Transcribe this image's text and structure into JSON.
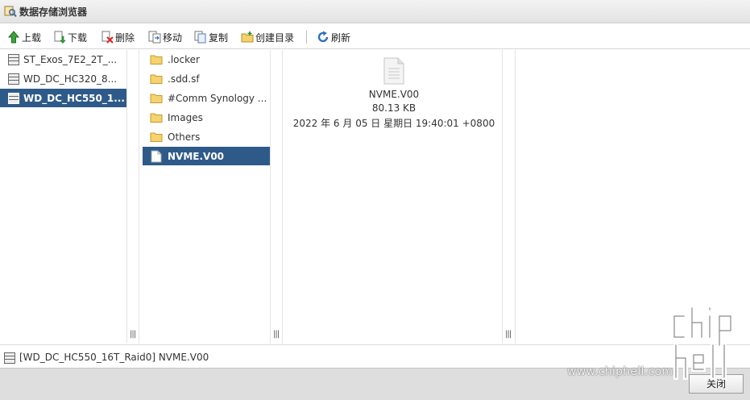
{
  "window": {
    "title": "数据存储浏览器"
  },
  "toolbar": {
    "upload": "上载",
    "download": "下载",
    "delete": "删除",
    "move": "移动",
    "copy": "复制",
    "mkdir": "创建目录",
    "refresh": "刷新"
  },
  "datastores": [
    {
      "label": "ST_Exos_7E2_2T_..."
    },
    {
      "label": "WD_DC_HC320_8..."
    },
    {
      "label": "WD_DC_HC550_1..."
    }
  ],
  "folders": [
    {
      "label": ".locker"
    },
    {
      "label": ".sdd.sf"
    },
    {
      "label": "#Comm Synology ..."
    },
    {
      "label": "Images"
    },
    {
      "label": "Others"
    },
    {
      "label": "NVME.V00"
    }
  ],
  "details": {
    "name": "NVME.V00",
    "size": "80.13 KB",
    "modified": "2022 年 6 月 05 日 星期日 19:40:01 +0800"
  },
  "status": {
    "path": "[WD_DC_HC550_16T_Raid0] NVME.V00"
  },
  "footer": {
    "close_label": "关闭"
  },
  "watermark": {
    "text": "www.chiphell.com",
    "logo": "chip hell"
  },
  "colors": {
    "selection": "#2e5a89",
    "footer": "#dedede"
  }
}
